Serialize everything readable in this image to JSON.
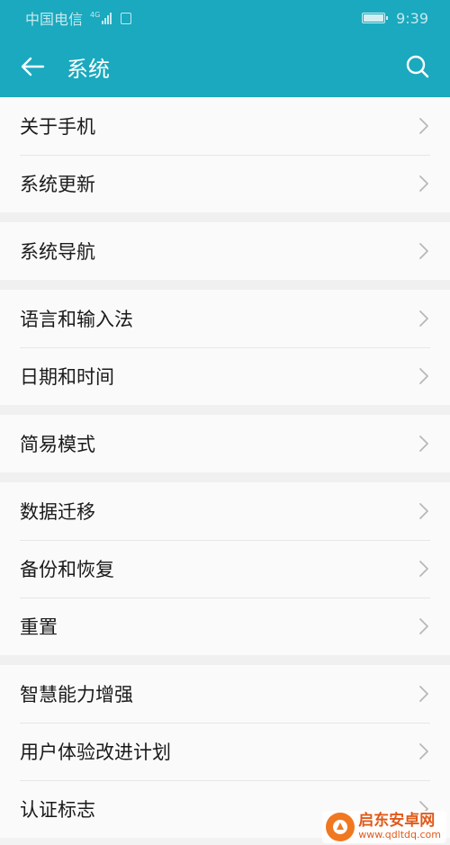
{
  "status_bar": {
    "carrier": "中国电信",
    "network": "4G",
    "time": "9:39"
  },
  "app_bar": {
    "title": "系统",
    "back_icon": "arrow-left-icon",
    "search_icon": "search-icon"
  },
  "groups": [
    {
      "items": [
        {
          "label": "关于手机"
        },
        {
          "label": "系统更新"
        }
      ]
    },
    {
      "items": [
        {
          "label": "系统导航"
        }
      ]
    },
    {
      "items": [
        {
          "label": "语言和输入法"
        },
        {
          "label": "日期和时间"
        }
      ]
    },
    {
      "items": [
        {
          "label": "简易模式"
        }
      ]
    },
    {
      "items": [
        {
          "label": "数据迁移"
        },
        {
          "label": "备份和恢复"
        },
        {
          "label": "重置"
        }
      ]
    },
    {
      "items": [
        {
          "label": "智慧能力增强"
        },
        {
          "label": "用户体验改进计划"
        },
        {
          "label": "认证标志"
        }
      ]
    }
  ],
  "watermark": {
    "name": "启东安卓网",
    "url": "www.qdltdq.com"
  },
  "colors": {
    "accent": "#1aa9be",
    "background": "#f2f2f2",
    "row_background": "#fafafa",
    "text": "#1a1a1a",
    "chevron": "#b8b8b8"
  }
}
